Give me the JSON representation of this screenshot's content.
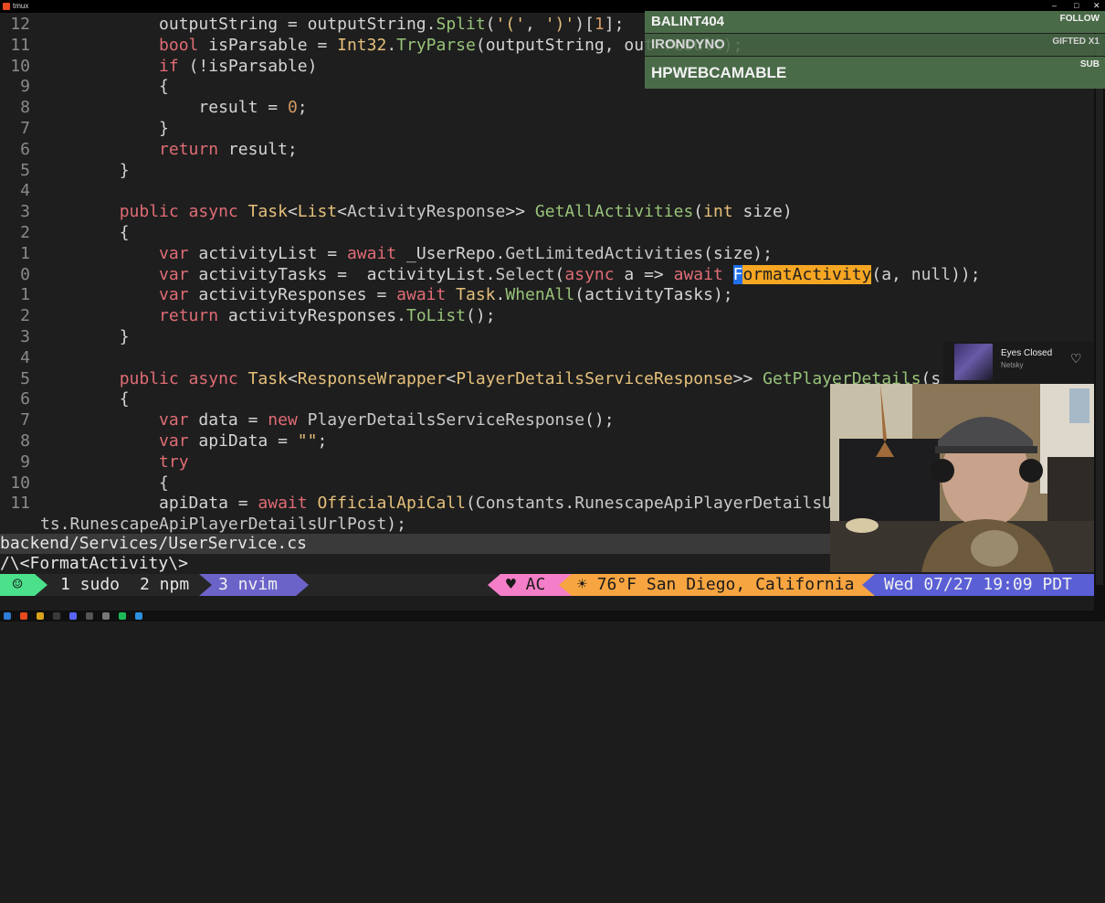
{
  "window": {
    "title": "tmux"
  },
  "editor": {
    "lines": [
      {
        "ln": "12",
        "tokens": [
          [
            "m",
            "            outputString = outputString."
          ],
          [
            "f",
            "Split"
          ],
          [
            "m",
            "("
          ],
          [
            "s",
            "'('"
          ],
          [
            "m",
            ", "
          ],
          [
            "s",
            "')'"
          ],
          [
            "m",
            ")["
          ],
          [
            "n",
            "1"
          ],
          [
            "m",
            "];"
          ]
        ]
      },
      {
        "ln": "11",
        "tokens": [
          [
            "m",
            "            "
          ],
          [
            "k",
            "bool"
          ],
          [
            "m",
            " isParsable = "
          ],
          [
            "t",
            "Int32"
          ],
          [
            "m",
            "."
          ],
          [
            "f",
            "TryParse"
          ],
          [
            "m",
            "(outputString, out result);"
          ]
        ]
      },
      {
        "ln": "10",
        "tokens": [
          [
            "m",
            "            "
          ],
          [
            "k",
            "if"
          ],
          [
            "m",
            " (!isParsable)"
          ]
        ]
      },
      {
        "ln": "9",
        "tokens": [
          [
            "m",
            "            {"
          ]
        ]
      },
      {
        "ln": "8",
        "tokens": [
          [
            "m",
            "                result = "
          ],
          [
            "n",
            "0"
          ],
          [
            "m",
            ";"
          ]
        ]
      },
      {
        "ln": "7",
        "tokens": [
          [
            "m",
            "            }"
          ]
        ]
      },
      {
        "ln": "6",
        "tokens": [
          [
            "m",
            "            "
          ],
          [
            "k",
            "return"
          ],
          [
            "m",
            " result;"
          ]
        ]
      },
      {
        "ln": "5",
        "tokens": [
          [
            "m",
            "        }"
          ]
        ]
      },
      {
        "ln": "4",
        "tokens": [
          [
            "m",
            ""
          ]
        ]
      },
      {
        "ln": "3",
        "tokens": [
          [
            "m",
            "        "
          ],
          [
            "k",
            "public async "
          ],
          [
            "t",
            "Task"
          ],
          [
            "m",
            "<"
          ],
          [
            "t",
            "List"
          ],
          [
            "m",
            "<"
          ],
          [
            "p",
            "ActivityResponse"
          ],
          [
            "m",
            ">> "
          ],
          [
            "f",
            "GetAllActivities"
          ],
          [
            "m",
            "("
          ],
          [
            "t",
            "int"
          ],
          [
            "m",
            " size)"
          ]
        ]
      },
      {
        "ln": "2",
        "tokens": [
          [
            "m",
            "        {"
          ]
        ]
      },
      {
        "ln": "1",
        "tokens": [
          [
            "m",
            "            "
          ],
          [
            "k",
            "var"
          ],
          [
            "m",
            " activityList = "
          ],
          [
            "k",
            "await"
          ],
          [
            "m",
            " _UserRepo."
          ],
          [
            "p",
            "GetLimitedActivities"
          ],
          [
            "m",
            "(size);"
          ]
        ]
      },
      {
        "ln": "0",
        "tokens": [
          [
            "m",
            "            "
          ],
          [
            "k",
            "var"
          ],
          [
            "m",
            " activityTasks =  activityList."
          ],
          [
            "p",
            "Select"
          ],
          [
            "m",
            "("
          ],
          [
            "k",
            "async"
          ],
          [
            "m",
            " a => "
          ],
          [
            "k",
            "await"
          ],
          [
            "m",
            " "
          ],
          [
            "cur",
            "F"
          ],
          [
            "hl",
            "ormatActivity"
          ],
          [
            "m",
            "(a, "
          ],
          [
            "p",
            "null"
          ],
          [
            "m",
            "));"
          ]
        ]
      },
      {
        "ln": "1",
        "tokens": [
          [
            "m",
            "            "
          ],
          [
            "k",
            "var"
          ],
          [
            "m",
            " activityResponses = "
          ],
          [
            "k",
            "await"
          ],
          [
            "m",
            " "
          ],
          [
            "t",
            "Task"
          ],
          [
            "m",
            "."
          ],
          [
            "f",
            "WhenAll"
          ],
          [
            "m",
            "(activityTasks);"
          ]
        ]
      },
      {
        "ln": "2",
        "tokens": [
          [
            "m",
            "            "
          ],
          [
            "k",
            "return"
          ],
          [
            "m",
            " activityResponses."
          ],
          [
            "f",
            "ToList"
          ],
          [
            "m",
            "();"
          ]
        ]
      },
      {
        "ln": "3",
        "tokens": [
          [
            "m",
            "        }"
          ]
        ]
      },
      {
        "ln": "4",
        "tokens": [
          [
            "m",
            ""
          ]
        ]
      },
      {
        "ln": "5",
        "tokens": [
          [
            "m",
            "        "
          ],
          [
            "k",
            "public async "
          ],
          [
            "t",
            "Task"
          ],
          [
            "m",
            "<"
          ],
          [
            "t",
            "ResponseWrapper"
          ],
          [
            "m",
            "<"
          ],
          [
            "t",
            "PlayerDetailsServiceResponse"
          ],
          [
            "m",
            ">> "
          ],
          [
            "f",
            "GetPlayerDetails"
          ],
          [
            "m",
            "(s"
          ]
        ]
      },
      {
        "ln": "6",
        "tokens": [
          [
            "m",
            "        {"
          ]
        ]
      },
      {
        "ln": "7",
        "tokens": [
          [
            "m",
            "            "
          ],
          [
            "k",
            "var"
          ],
          [
            "m",
            " data = "
          ],
          [
            "k",
            "new"
          ],
          [
            "m",
            " "
          ],
          [
            "p",
            "PlayerDetailsServiceResponse"
          ],
          [
            "m",
            "();"
          ]
        ]
      },
      {
        "ln": "8",
        "tokens": [
          [
            "m",
            "            "
          ],
          [
            "k",
            "var"
          ],
          [
            "m",
            " apiData = "
          ],
          [
            "s",
            "\"\""
          ],
          [
            "m",
            ";"
          ]
        ]
      },
      {
        "ln": "9",
        "tokens": [
          [
            "m",
            "            "
          ],
          [
            "k",
            "try"
          ]
        ]
      },
      {
        "ln": "10",
        "tokens": [
          [
            "m",
            "            {"
          ]
        ]
      },
      {
        "ln": "11",
        "tokens": [
          [
            "m",
            "            apiData = "
          ],
          [
            "k",
            "await"
          ],
          [
            "m",
            " "
          ],
          [
            "t",
            "OfficialApiCall"
          ],
          [
            "m",
            "("
          ],
          [
            "p",
            "Constants"
          ],
          [
            "m",
            "."
          ],
          [
            "p",
            "RunescapeApiPlayerDetailsU"
          ]
        ]
      },
      {
        "ln": "",
        "tokens": [
          [
            "p",
            "ts.RunescapeApiPlayerDetailsUrlPost"
          ],
          [
            "m",
            ");"
          ]
        ]
      }
    ]
  },
  "statusline": {
    "file": "backend/Services/UserService.cs",
    "search": "/\\<FormatActivity\\>"
  },
  "tmux": {
    "session_icon": "☺",
    "windows": [
      "1 sudo",
      "2 npm",
      "3 nvim"
    ],
    "right": {
      "ac": "♥ AC",
      "weather": "☀ 76°F San Diego, California",
      "datetime": "Wed 07/27 19:09 PDT"
    }
  },
  "alerts": [
    {
      "name": "BALINT404",
      "type": "FOLLOW"
    },
    {
      "name": "IRONDYNO",
      "type": "GIFTED X1"
    },
    {
      "name": "HPWEBCAMABLE",
      "type": "SUB"
    }
  ],
  "music": {
    "title": "Eyes Closed",
    "artist": "Netsky"
  },
  "colors": {
    "accent_green": "#4be08a",
    "accent_purple": "#6c63c9",
    "accent_pink": "#f57ec8",
    "accent_orange": "#f7a541",
    "accent_blue": "#5a5fd6"
  }
}
